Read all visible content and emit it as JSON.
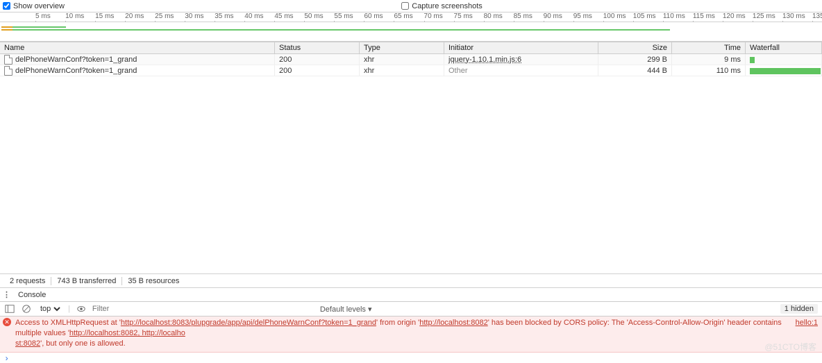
{
  "toolbar": {
    "show_overview_label": "Show overview",
    "show_overview_checked": true,
    "capture_label": "Capture screenshots",
    "capture_checked": false
  },
  "timeline": {
    "ticks": [
      "5 ms",
      "10 ms",
      "15 ms",
      "20 ms",
      "25 ms",
      "30 ms",
      "35 ms",
      "40 ms",
      "45 ms",
      "50 ms",
      "55 ms",
      "60 ms",
      "65 ms",
      "70 ms",
      "75 ms",
      "80 ms",
      "85 ms",
      "90 ms",
      "95 ms",
      "100 ms",
      "105 ms",
      "110 ms",
      "115 ms",
      "120 ms",
      "125 ms",
      "130 ms",
      "135"
    ],
    "max_ms": 135,
    "overview_bars": [
      {
        "start": 0,
        "end": 9,
        "color": "#67c76a",
        "lead": "#e0a020"
      },
      {
        "start": 0,
        "end": 110,
        "color": "#67c76a",
        "lead": "#e0a020"
      }
    ]
  },
  "columns": {
    "name": "Name",
    "status": "Status",
    "type": "Type",
    "initiator": "Initiator",
    "size": "Size",
    "time": "Time",
    "waterfall": "Waterfall"
  },
  "rows": [
    {
      "name": "delPhoneWarnConf?token=1_grand",
      "status": "200",
      "type": "xhr",
      "initiator": "jquery-1.10.1.min.js:6",
      "initiator_link": true,
      "size": "299 B",
      "time": "9 ms",
      "wf_start": 0,
      "wf_end": 9
    },
    {
      "name": "delPhoneWarnConf?token=1_grand",
      "status": "200",
      "type": "xhr",
      "initiator": "Other",
      "initiator_link": false,
      "size": "444 B",
      "time": "110 ms",
      "wf_start": 0,
      "wf_end": 135
    }
  ],
  "summary": {
    "requests": "2 requests",
    "transferred": "743 B transferred",
    "resources": "35 B resources"
  },
  "console": {
    "tab_label": "Console",
    "context": "top",
    "filter_placeholder": "Filter",
    "levels": "Default levels ▾",
    "hidden": "1 hidden",
    "error_prefix": "Access to XMLHttpRequest at '",
    "error_url1": "http://localhost:8083/plupgrade/app/api/delPhoneWarnConf?token=1_grand",
    "error_mid1": "' from origin '",
    "error_url2": "http://localhost:8082",
    "error_mid2": "' has been blocked by CORS policy: The 'Access-Control-Allow-Origin' header contains multiple values '",
    "error_url3": "http://localhost:8082, http://localho",
    "error_tail_link": "st:8082",
    "error_tail": "', but only one is allowed.",
    "error_rightref": "hello:1"
  },
  "watermark": "@51CTO博客"
}
